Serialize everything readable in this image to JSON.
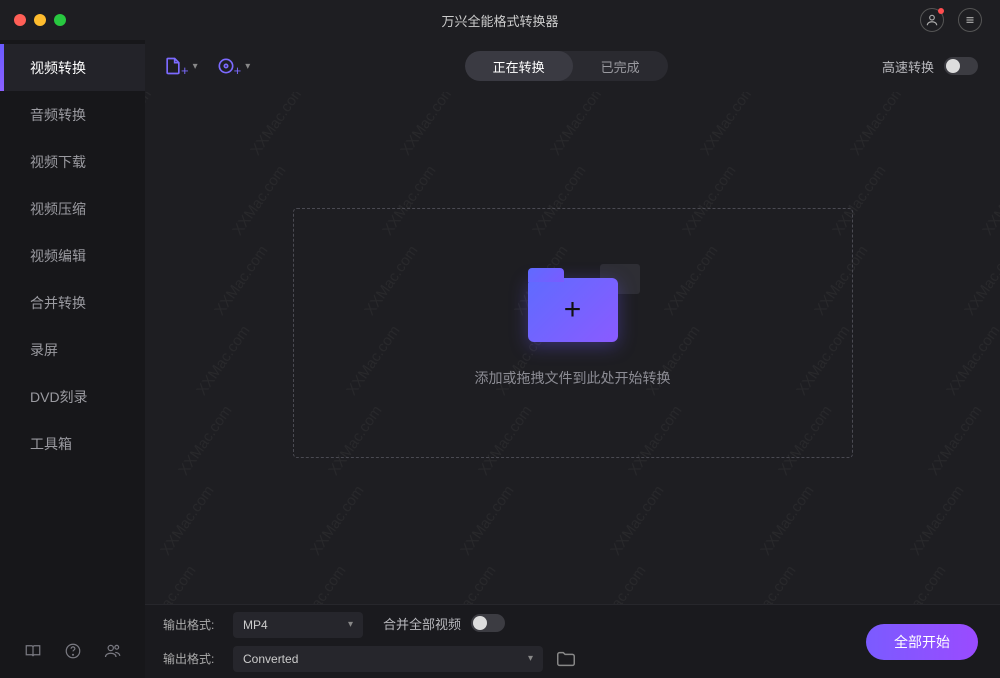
{
  "window": {
    "title": "万兴全能格式转换器"
  },
  "sidebar": {
    "items": [
      {
        "label": "视频转换"
      },
      {
        "label": "音频转换"
      },
      {
        "label": "视频下载"
      },
      {
        "label": "视频压缩"
      },
      {
        "label": "视频编辑"
      },
      {
        "label": "合并转换"
      },
      {
        "label": "录屏"
      },
      {
        "label": "DVD刻录"
      },
      {
        "label": "工具箱"
      }
    ]
  },
  "toolbar": {
    "tabs": [
      {
        "label": "正在转换",
        "active": true
      },
      {
        "label": "已完成",
        "active": false
      }
    ],
    "fast_label": "高速转换"
  },
  "dropzone": {
    "text": "添加或拖拽文件到此处开始转换"
  },
  "watermark": "XXMac.com",
  "footer": {
    "format_label": "输出格式:",
    "format_value": "MP4",
    "path_label": "输出格式:",
    "path_value": "Converted",
    "merge_label": "合并全部视频",
    "start_label": "全部开始"
  }
}
